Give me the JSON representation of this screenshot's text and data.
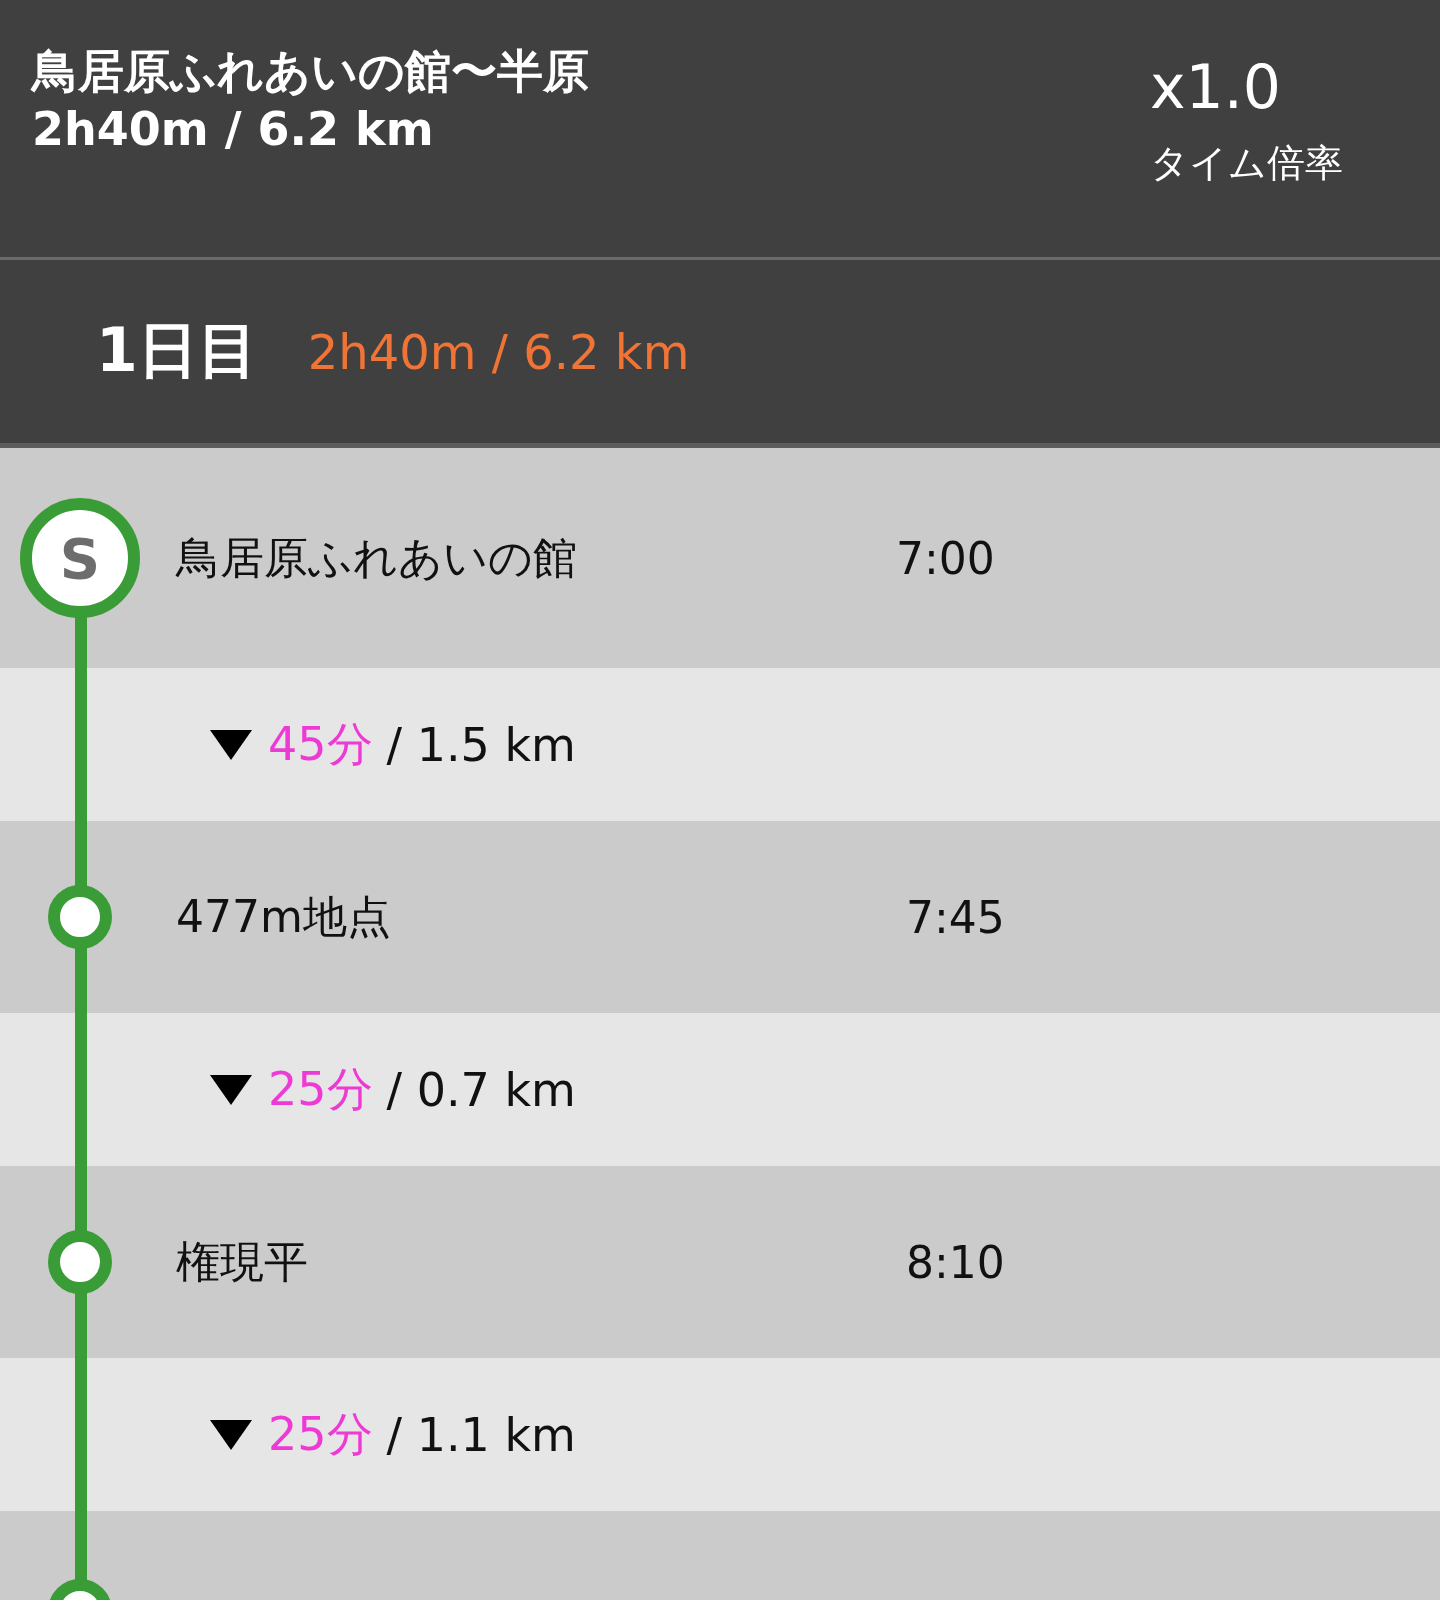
{
  "header": {
    "title": "鳥居原ふれあいの館〜半原",
    "summary": "2h40m / 6.2 km",
    "multiplier": "x1.0",
    "multiplier_label": "タイム倍率"
  },
  "day": {
    "label": "1日目",
    "summary": "2h40m / 6.2 km"
  },
  "timeline": [
    {
      "kind": "stop",
      "marker": "S",
      "name": "鳥居原ふれあいの館",
      "time": "7:00"
    },
    {
      "kind": "segment",
      "duration": "45分",
      "distance": "/ 1.5 km"
    },
    {
      "kind": "stop",
      "name": "477m地点",
      "time": "7:45"
    },
    {
      "kind": "segment",
      "duration": "25分",
      "distance": "/ 0.7 km"
    },
    {
      "kind": "stop",
      "name": "権現平",
      "time": "8:10"
    },
    {
      "kind": "segment",
      "duration": "25分",
      "distance": "/ 1.1 km"
    },
    {
      "kind": "stop"
    }
  ]
}
